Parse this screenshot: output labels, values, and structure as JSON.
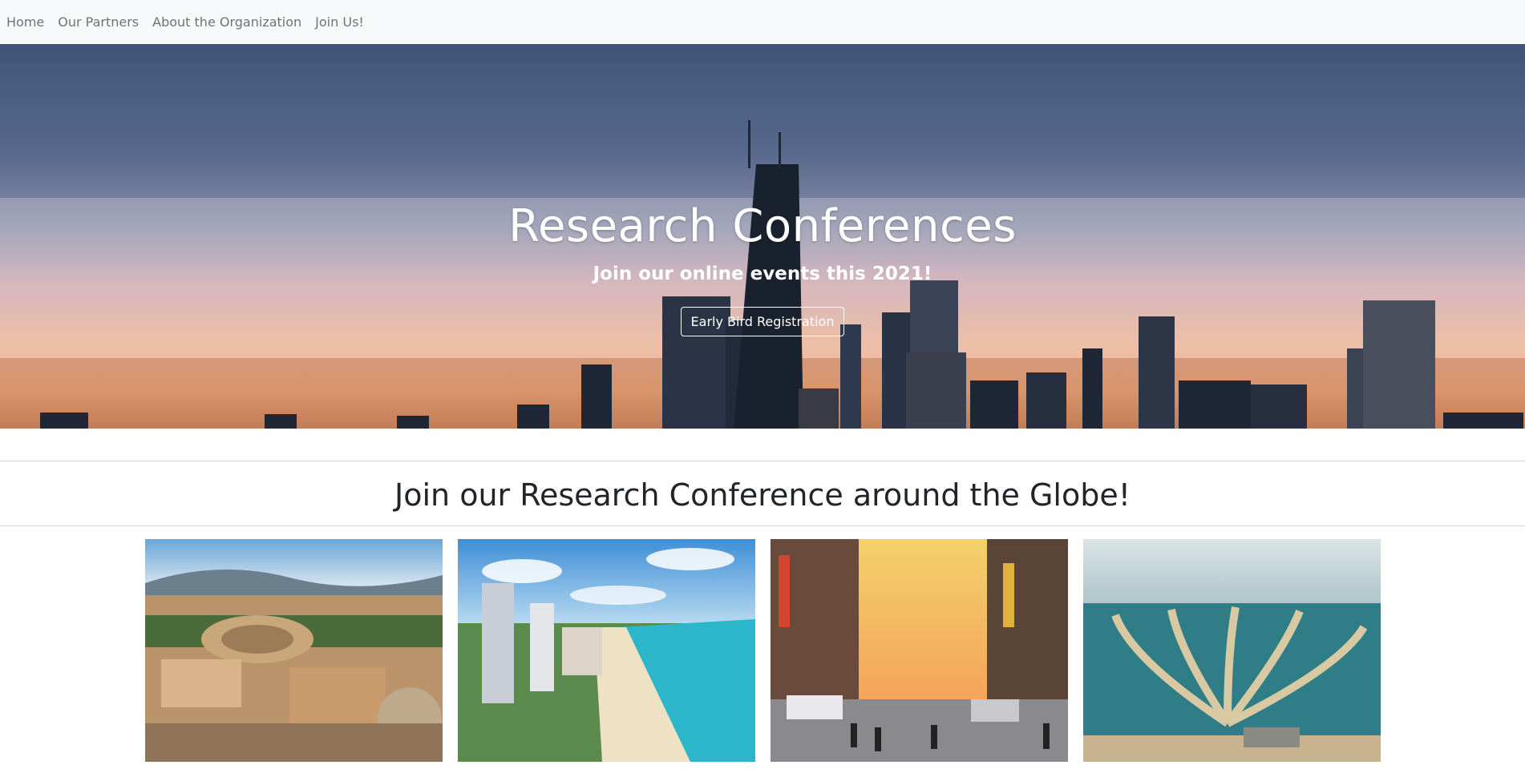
{
  "navbar": {
    "links": [
      "Home",
      "Our Partners",
      "About the Organization",
      "Join Us!"
    ]
  },
  "hero": {
    "title": "Research Conferences",
    "subtitle": "Join our online events this 2021!",
    "button_label": "Early Bird Registration"
  },
  "section": {
    "title": "Join our Research Conference around the Globe!"
  },
  "colors": {
    "navbar_bg": "#f8f9fa",
    "text": "#212529"
  }
}
